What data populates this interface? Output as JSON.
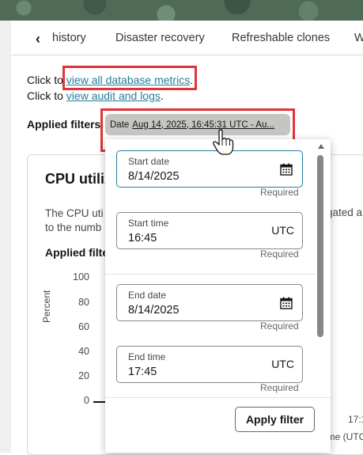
{
  "tabs": {
    "back_icon": "chevron-left-icon",
    "items": [
      {
        "label": "history"
      },
      {
        "label": "Disaster recovery"
      },
      {
        "label": "Refreshable clones"
      },
      {
        "label": "W"
      }
    ]
  },
  "links": {
    "line1_prefix": "Click to ",
    "line1_link": "view all database metrics",
    "line1_suffix": ".",
    "line2_prefix": "Click to ",
    "line2_link": "view audit and logs",
    "line2_suffix": "."
  },
  "applied_filters_label": "Applied filters",
  "filter_chip": {
    "key": "Date",
    "value": "Aug 14, 2025, 16:45:31 UTC - Au..."
  },
  "card": {
    "title": "CPU utiliz",
    "description_line1": "The CPU uti",
    "description_line1_right": "gated a",
    "description_line2": "to the numb",
    "applied_label": "Applied filte",
    "y_axis_label": "Percent",
    "y_ticks": [
      "100",
      "80",
      "60",
      "40",
      "20",
      "0"
    ],
    "x_tick_right": "17:1",
    "x_label_right": "ime (UTC"
  },
  "popup": {
    "start_date": {
      "label": "Start date",
      "value": "8/14/2025",
      "hint": "Required"
    },
    "start_time": {
      "label": "Start time",
      "value": "16:45",
      "suffix": "UTC",
      "hint": "Required"
    },
    "end_date": {
      "label": "End date",
      "value": "8/14/2025",
      "hint": "Required"
    },
    "end_time": {
      "label": "End time",
      "value": "17:45",
      "suffix": "UTC",
      "hint": "Required"
    },
    "apply_button": "Apply filter"
  },
  "colors": {
    "link": "#227e9e",
    "highlight_box": "#e0343a",
    "chip_bg": "#c7c5c2"
  }
}
